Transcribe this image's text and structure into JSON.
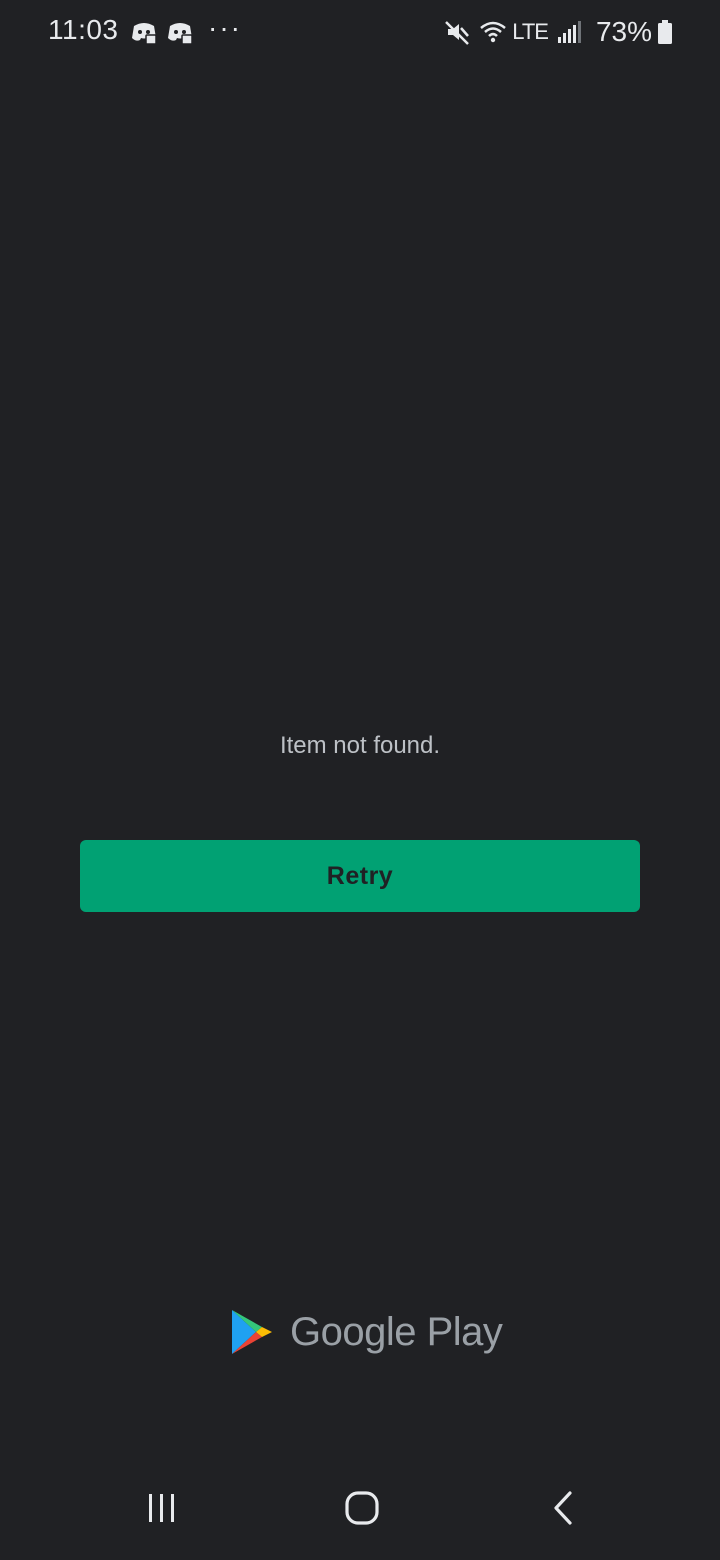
{
  "status_bar": {
    "time": "11:03",
    "notification_icons": [
      "discord-icon",
      "discord-icon"
    ],
    "more": "···",
    "network": "LTE",
    "battery": "73%",
    "icons": [
      "mute-icon",
      "wifi-icon",
      "signal-icon",
      "battery-icon"
    ]
  },
  "content": {
    "message": "Item not found.",
    "retry_label": "Retry"
  },
  "brand": {
    "name": "Google Play"
  },
  "colors": {
    "background": "#202124",
    "accent": "#01a173",
    "text": "#bdc1c6"
  },
  "nav_bar": {
    "icons": [
      "recents-icon",
      "home-icon",
      "back-icon"
    ]
  }
}
